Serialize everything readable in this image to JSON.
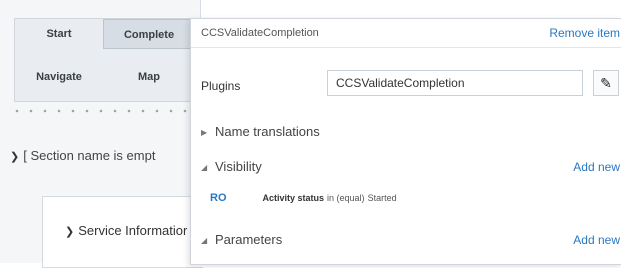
{
  "left": {
    "buttons": {
      "start": "Start",
      "complete": "Complete",
      "navigate": "Navigate",
      "map": "Map"
    },
    "section_label": "[ Section name is empt",
    "service_label": "Service Informatior"
  },
  "panel": {
    "title": "CCSValidateCompletion",
    "remove_label": "Remove item",
    "plugins_label": "Plugins",
    "plugins_value": "CCSValidateCompletion",
    "name_translations_label": "Name translations",
    "visibility_label": "Visibility",
    "visibility_add": "Add new",
    "rule": {
      "code": "RO",
      "key": "Activity status",
      "operator": "in (equal)",
      "value": "Started"
    },
    "parameters_label": "Parameters",
    "parameters_add": "Add new"
  }
}
